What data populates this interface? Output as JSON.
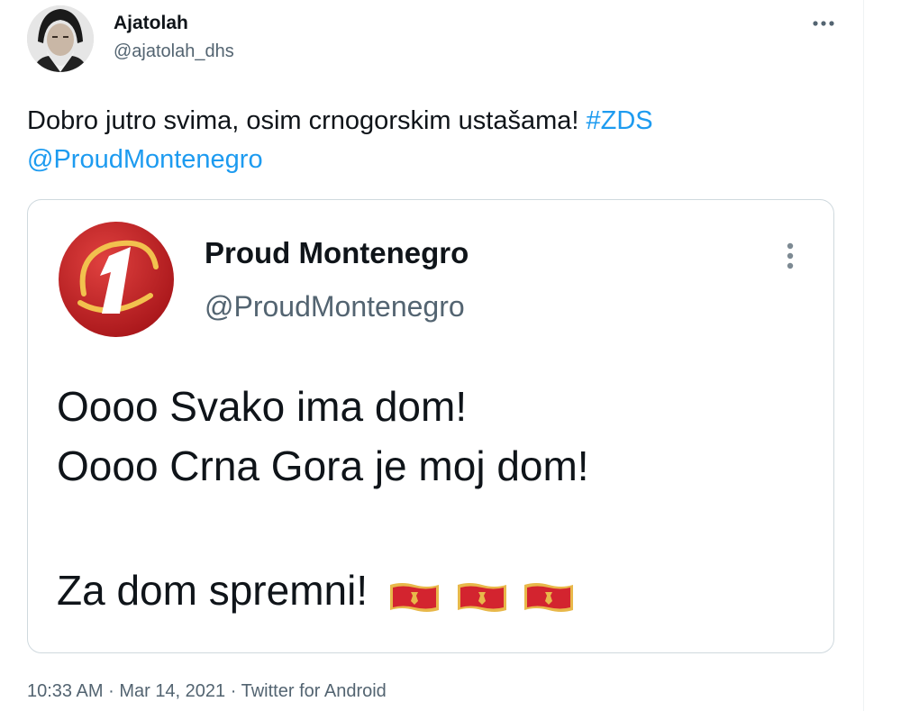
{
  "author": {
    "name": "Ajatolah",
    "handle": "@ajatolah_dhs",
    "avatar_icon": "portrait-avatar"
  },
  "header": {
    "more_icon": "ellipsis-horizontal-icon"
  },
  "tweet": {
    "text_plain": "Dobro jutro svima, osim crnogorskim ustašama!",
    "hashtag": "#ZDS",
    "mention": "@ProudMontenegro"
  },
  "quoted": {
    "name": "Proud Montenegro",
    "handle": "@ProudMontenegro",
    "logo_icon": "number-one-logo",
    "more_icon": "ellipsis-vertical-icon",
    "lines": [
      "Oooo Svako ima dom!",
      "Oooo Crna Gora je moj dom!"
    ],
    "closing": "Za dom spremni!",
    "flag_icons": [
      "montenegro-flag-icon",
      "montenegro-flag-icon",
      "montenegro-flag-icon"
    ]
  },
  "meta": {
    "time": "10:33 AM",
    "separator": "·",
    "date": "Mar 14, 2021",
    "source": "Twitter for Android"
  },
  "colors": {
    "link": "#1d9bf0",
    "secondary_text": "#536471",
    "primary_text": "#0f1419",
    "border": "#cfd9de",
    "flag_red": "#d3242f",
    "flag_gold": "#e8b84a"
  }
}
